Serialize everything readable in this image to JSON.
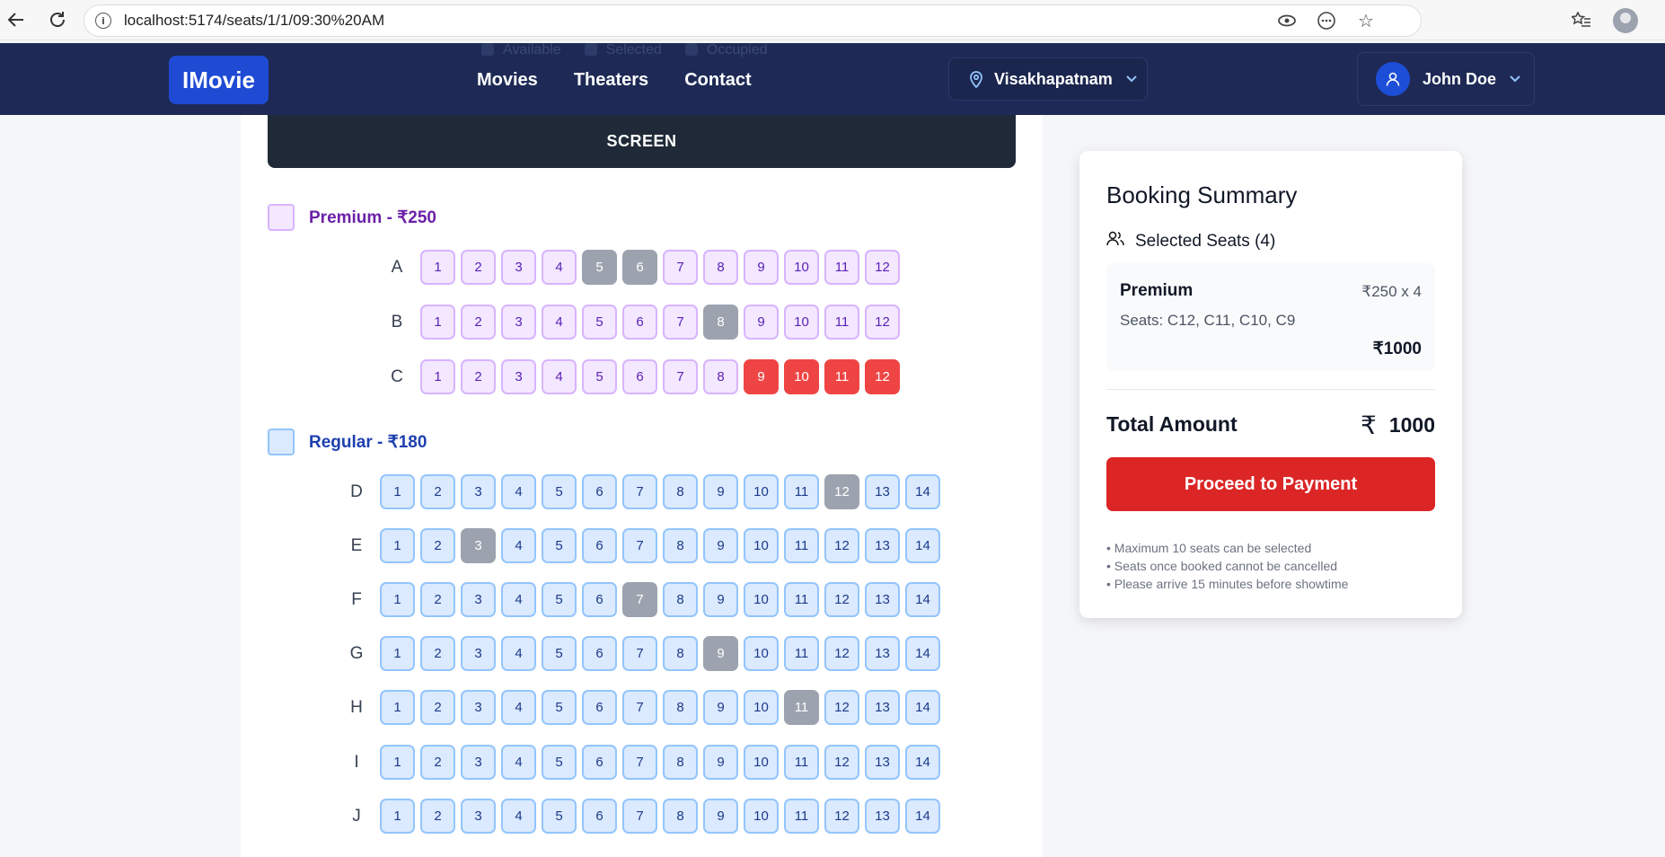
{
  "browser": {
    "url": "localhost:5174/seats/1/1/09:30%20AM"
  },
  "navbar": {
    "logo": "IMovie",
    "links": [
      "Movies",
      "Theaters",
      "Contact"
    ],
    "city": "Visakhapatnam",
    "user": "John Doe",
    "legend_ghost": [
      "Available",
      "Selected",
      "Occupied"
    ]
  },
  "screen_label": "SCREEN",
  "categories": [
    {
      "title": "Premium - ₹250",
      "type": "premium",
      "rows": [
        {
          "label": "A",
          "seats": 12,
          "occupied": [
            5,
            6
          ],
          "selected": []
        },
        {
          "label": "B",
          "seats": 12,
          "occupied": [
            8
          ],
          "selected": []
        },
        {
          "label": "C",
          "seats": 12,
          "occupied": [],
          "selected": [
            9,
            10,
            11,
            12
          ]
        }
      ]
    },
    {
      "title": "Regular - ₹180",
      "type": "regular",
      "rows": [
        {
          "label": "D",
          "seats": 14,
          "occupied": [
            12
          ],
          "selected": []
        },
        {
          "label": "E",
          "seats": 14,
          "occupied": [
            3
          ],
          "selected": []
        },
        {
          "label": "F",
          "seats": 14,
          "occupied": [
            7
          ],
          "selected": []
        },
        {
          "label": "G",
          "seats": 14,
          "occupied": [
            9
          ],
          "selected": []
        },
        {
          "label": "H",
          "seats": 14,
          "occupied": [
            11
          ],
          "selected": []
        },
        {
          "label": "I",
          "seats": 14,
          "occupied": [],
          "selected": []
        },
        {
          "label": "J",
          "seats": 14,
          "occupied": [],
          "selected": []
        }
      ]
    }
  ],
  "summary": {
    "title": "Booking Summary",
    "selected_seats_heading": "Selected Seats (4)",
    "category": "Premium",
    "calc": "₹250 x 4",
    "seats_list": "Seats: C12, C11, C10, C9",
    "subtotal": "₹1000",
    "total_label": "Total Amount",
    "currency": "₹",
    "total_value": "1000",
    "pay_button": "Proceed to Payment",
    "notes": [
      "• Maximum 10 seats can be selected",
      "• Seats once booked cannot be cancelled",
      "• Please arrive 15 minutes before showtime"
    ]
  },
  "colors": {
    "navbar": "#1e2a55",
    "accent": "#1f4ad4",
    "selected": "#ef4444",
    "occupied": "#9ca3af",
    "premium": "#f3e8ff",
    "regular": "#dbeafe",
    "pay": "#dc2626"
  }
}
